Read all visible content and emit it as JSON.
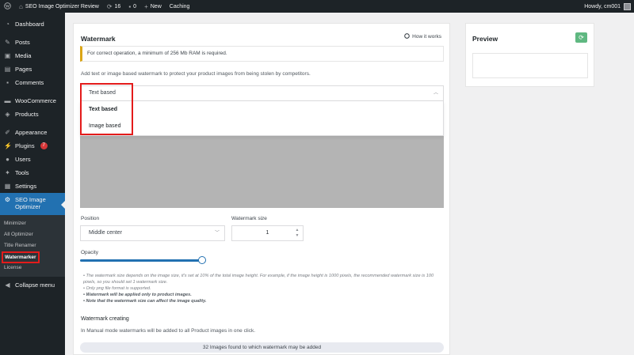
{
  "adminbar": {
    "site_name": "SEO Image Optimizer Review",
    "updates_count": "16",
    "comments_count": "0",
    "new_label": "New",
    "caching_label": "Caching",
    "howdy": "Howdy, cm001"
  },
  "sidebar": {
    "dashboard": "Dashboard",
    "posts": "Posts",
    "media": "Media",
    "pages": "Pages",
    "comments": "Comments",
    "woocommerce": "WooCommerce",
    "products": "Products",
    "appearance": "Appearance",
    "plugins": "Plugins",
    "plugins_badge": "7",
    "users": "Users",
    "tools": "Tools",
    "settings": "Settings",
    "seo_line1": "SEO Image",
    "seo_line2": "Optimizer",
    "submenu": {
      "minimizer": "Minimizer",
      "all_optimizer": "All Optimizer",
      "title_renamer": "Title Renamer",
      "watermarker": "Watermarker",
      "license": "License"
    },
    "collapse": "Collapse menu"
  },
  "watermark": {
    "title": "Watermark",
    "how_it_works": "How it works",
    "notice": "For correct operation, a minimum of 256 Mb RAM is required.",
    "description": "Add text or image based watermark to protect your product images from being stolen by competitors.",
    "type_select_value": "Text based",
    "type_options": [
      "Text based",
      "Image based"
    ],
    "position_label": "Position",
    "position_value": "Middle center",
    "size_label": "Watermark size",
    "size_value": "1",
    "opacity_label": "Opacity",
    "opacity_level": 1.0,
    "notes": [
      "The watermark size depends on the image size, it's set at 10% of the total image height. For example, if the image height is 1000 pixels, the recommended watermark size is 100 pixels, so you should set 1 watermark size.",
      "Only png file format is supported.",
      "Watermark will be applied only to product images.",
      "Note that the watermark size can affect the image quality."
    ],
    "creating_title": "Watermark creating",
    "creating_desc": "In Manual mode watermarks will be added to all Product images in one click.",
    "found_text": "32 Images found to which watermark may be added"
  },
  "preview": {
    "title": "Preview"
  },
  "colors": {
    "accent": "#2271b1",
    "highlight": "#e31b1b",
    "refresh": "#5fb881"
  }
}
